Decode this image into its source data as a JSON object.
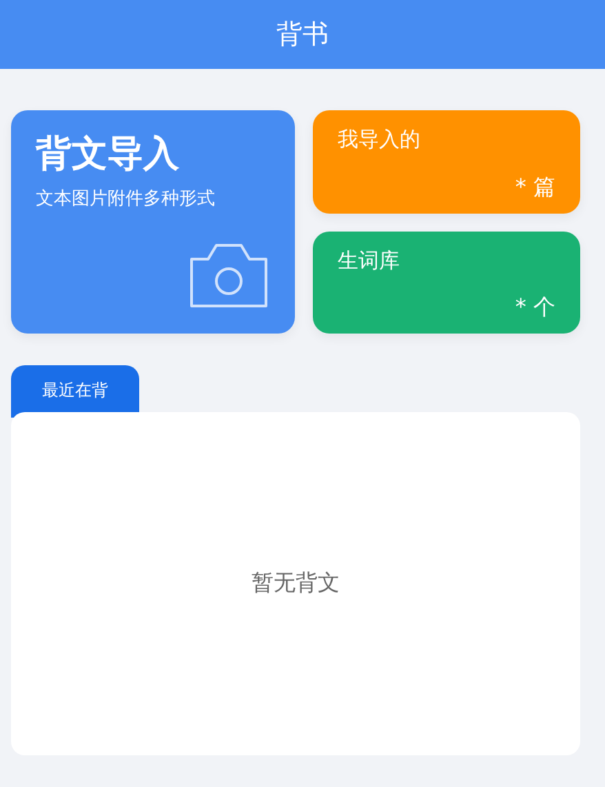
{
  "header": {
    "title": "背书"
  },
  "import_card": {
    "title": "背文导入",
    "subtitle": "文本图片附件多种形式"
  },
  "stat_cards": [
    {
      "label": "我导入的",
      "count": "* 篇",
      "color": "#ff9100"
    },
    {
      "label": "生词库",
      "count": "* 个",
      "color": "#1ab273"
    }
  ],
  "recent": {
    "tab": {
      "label": "最近在背",
      "selected": true
    },
    "empty_text": "暂无背文"
  }
}
